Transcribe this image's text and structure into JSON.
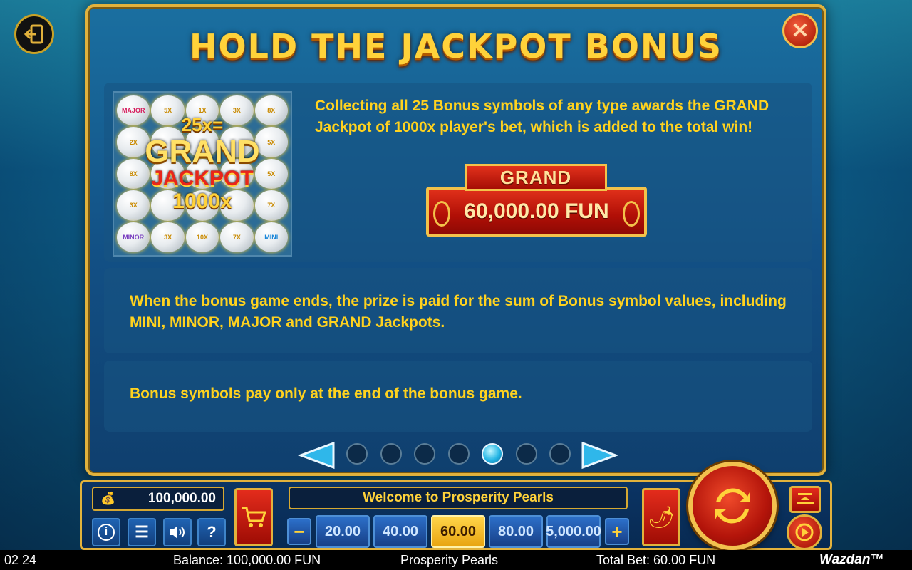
{
  "title": "HOLD THE JACKPOT BONUS",
  "close_label": "✕",
  "image": {
    "pearls": [
      {
        "label": "MAJOR",
        "kind": "major"
      },
      {
        "label": "5X",
        "kind": "x"
      },
      {
        "label": "1X",
        "kind": "x"
      },
      {
        "label": "3X",
        "kind": "x"
      },
      {
        "label": "8X",
        "kind": "x"
      },
      {
        "label": "2X",
        "kind": "x"
      },
      {
        "label": "",
        "kind": "x"
      },
      {
        "label": "",
        "kind": "x"
      },
      {
        "label": "",
        "kind": "x"
      },
      {
        "label": "5X",
        "kind": "x"
      },
      {
        "label": "8X",
        "kind": "x"
      },
      {
        "label": "",
        "kind": "x"
      },
      {
        "label": "",
        "kind": "x"
      },
      {
        "label": "",
        "kind": "x"
      },
      {
        "label": "5X",
        "kind": "x"
      },
      {
        "label": "3X",
        "kind": "x"
      },
      {
        "label": "",
        "kind": "x"
      },
      {
        "label": "",
        "kind": "x"
      },
      {
        "label": "",
        "kind": "x"
      },
      {
        "label": "7X",
        "kind": "x"
      },
      {
        "label": "MINOR",
        "kind": "minor"
      },
      {
        "label": "3X",
        "kind": "x"
      },
      {
        "label": "10X",
        "kind": "x"
      },
      {
        "label": "7X",
        "kind": "x"
      },
      {
        "label": "MINI",
        "kind": "mini"
      }
    ],
    "overlay_line1": "25x=",
    "overlay_line2": "GRAND",
    "overlay_line3": "JACKPOT",
    "overlay_line4": "1000x"
  },
  "text1": "Collecting all 25 Bonus symbols of any type awards the GRAND Jackpot of 1000x player's bet, which is added to the total win!",
  "grand_label": "GRAND",
  "grand_value": "60,000.00 FUN",
  "text2": "When the bonus game ends, the prize is paid for the sum of Bonus symbol values, including MINI, MINOR, MAJOR and GRAND Jackpots.",
  "text3": "Bonus symbols pay only at the end of the bonus game.",
  "pager": {
    "count": 7,
    "active": 5
  },
  "controls": {
    "balance": "100,000.00",
    "welcome": "Welcome to Prosperity Pearls",
    "info": "i",
    "help": "?",
    "bets": [
      "20.00",
      "40.00",
      "60.00",
      "80.00",
      "5,000.00"
    ],
    "active_bet": 2,
    "minus": "−",
    "plus": "+"
  },
  "status": {
    "clock": "02 24",
    "balance": "Balance: 100,000.00 FUN",
    "game": "Prosperity Pearls",
    "total_bet": "Total Bet: 60.00 FUN",
    "brand": "Wazdan™"
  },
  "colors": {
    "accent": "#ffd21e",
    "gold": "#e2b23c",
    "red": "#b00f06"
  },
  "icons": [
    "exit-icon",
    "close-icon",
    "cart-icon",
    "info-icon",
    "menu-icon",
    "sound-icon",
    "help-icon",
    "chili-icon",
    "spin-icon",
    "autoplay-icon",
    "hat-icon"
  ]
}
